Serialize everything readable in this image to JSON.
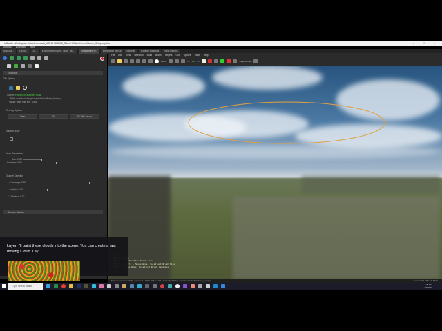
{
  "window": {
    "title": "idStudio - Workspace: idtools.devdata_id001/HB08050_Silent / Rikkie/Hexen/Hexen_Shipping.idws",
    "controls": "– □ ×"
  },
  "menu": [
    "idStudio",
    "Windows",
    "Help"
  ],
  "tabs": [
    {
      "label": "Map Ma..."
    },
    {
      "label": "Explor..."
    },
    {
      "label": "D..."
    },
    {
      "label": "EnvironmentEditor - (clear_sea..."
    },
    {
      "label": "Environment P...",
      "active": true
    },
    {
      "label": "worldofwar_fanCa"
    },
    {
      "label": "Explorer"
    },
    {
      "label": "Console Windows"
    },
    {
      "label": "View Options"
    }
  ],
  "left": {
    "edit_tools": "Edit Tools",
    "tile_options": "Tile Options",
    "source_label": "Source:",
    "source_value": "Packed Environment Atlas",
    "path": "Path: env/clouds/maps/user/edenhalt/hmm_bend_a",
    "image": "Image: slide_test_env_a.tga",
    "clearing_options": "Clearing Options",
    "btn_clear": "Clear",
    "btn_fill": "Fill",
    "btn_fill_values": "Fill With Values",
    "drawing_mode": "Drawing Mode",
    "brush_parameters": "Brush Parameters",
    "size": "Size: 2400",
    "hardness": "Hardness: 0.50",
    "channel_selection": "Channel Selection",
    "coverage": "Coverage: 0.90",
    "height": "Height: 0.50",
    "shadow": "Shadow: 0.00",
    "coverage_value": 0.9,
    "height_value": 0.5,
    "size_value": 0.5,
    "hardness_value": 0.5,
    "coverage_checked": true,
    "height_checked": true,
    "shadow_checked": false,
    "contour_section": "Contour Section"
  },
  "viewport": {
    "menu": [
      "File",
      "Edit",
      "View",
      "Selection",
      "Build",
      "Brush",
      "Targets",
      "Grid",
      "Options",
      "Tools",
      "Help"
    ],
    "zoom": "100%",
    "counts": [
      "0.6",
      "1.0",
      "1.0"
    ],
    "snap": "Snap To View",
    "title": "ENVIRONMENT PAINTER - CLOUD PAINTER MODE"
  },
  "console": [
    "Paint",
    "LMB to Erase",
    "Shift + LMB Smoother Paint Area",
    "Shift (+ Ctrl) + Mouse Wheel to adjust Brush Size",
    "Shift + Mouse Wheel to adjust Brush Hardness"
  ],
  "status": {
    "left": "Map saved successfully:  coreinput.c 1363: 448,0 7133 | Currently Editing: maps/user/edenhalt/hmm_bend_a",
    "right": "0.7ms  1920 FPS  LAUNCH"
  },
  "caption": "Layer. I'll paint these clouds into the scene. You can create a fast moving Cloud. Lay",
  "taskbar": {
    "search_placeholder": "Type here to search",
    "time": "4:46 PM",
    "date": "1/1/2020"
  }
}
